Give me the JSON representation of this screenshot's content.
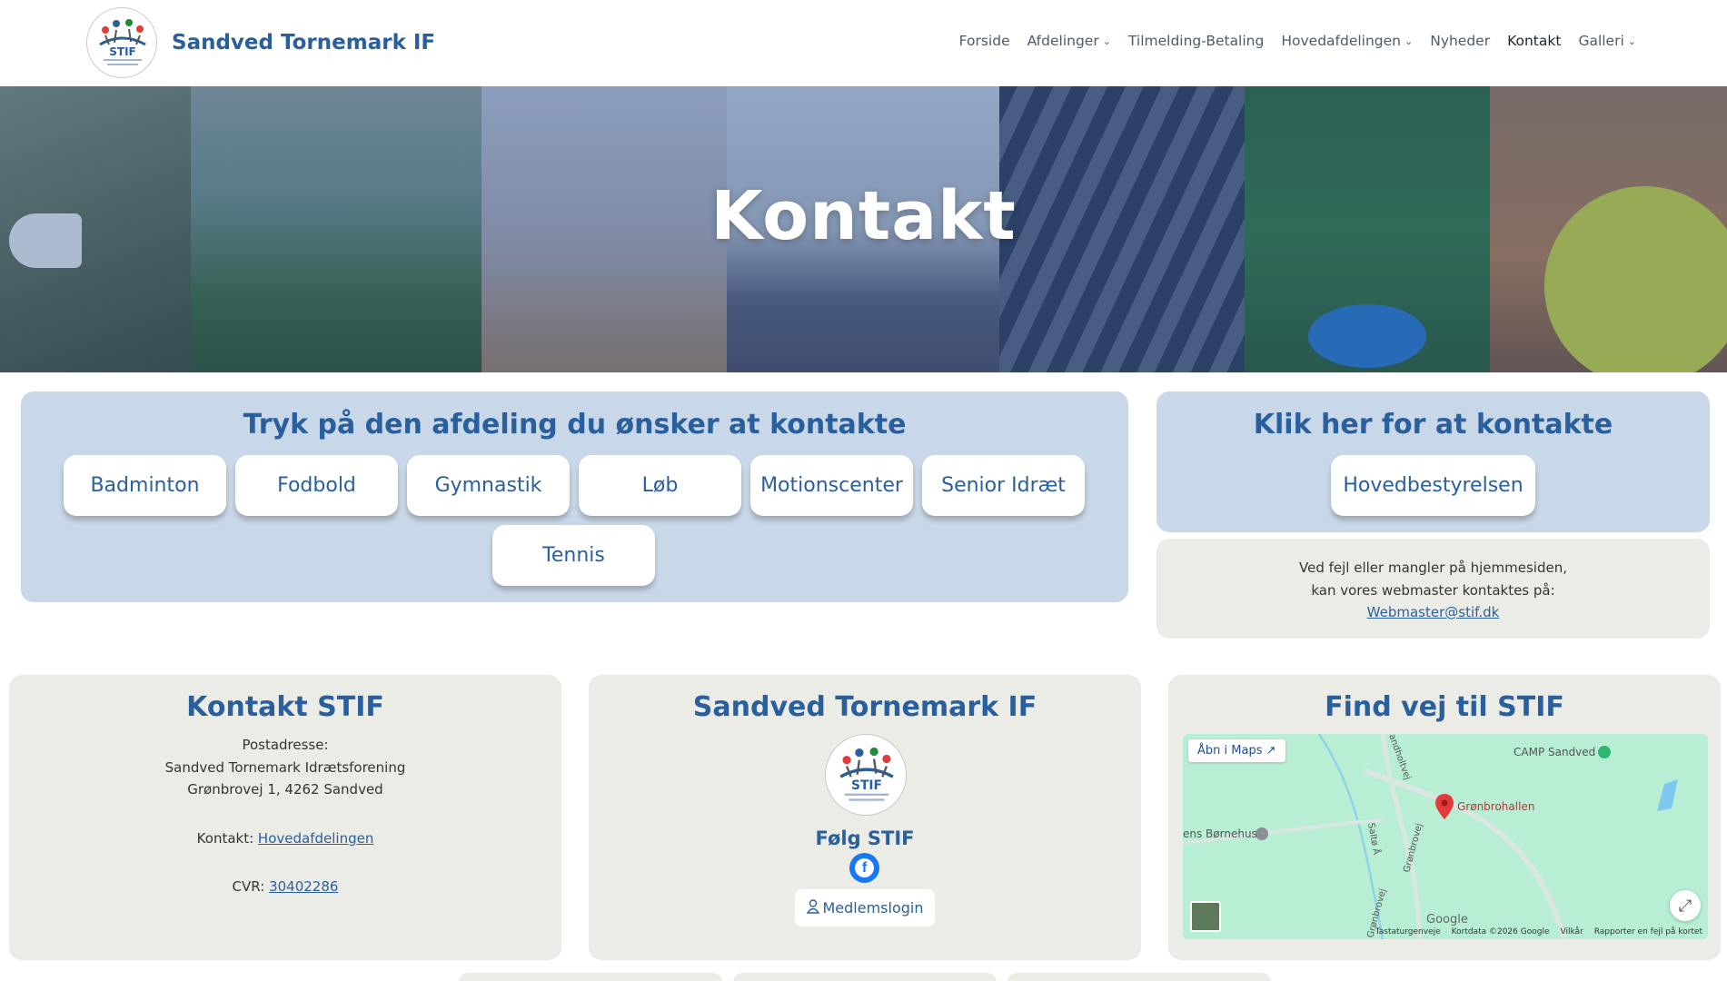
{
  "site": {
    "title": "Sandved Tornemark IF",
    "logo_text": "STIF"
  },
  "nav": {
    "items": [
      {
        "label": "Forside",
        "dropdown": false,
        "active": false
      },
      {
        "label": "Afdelinger",
        "dropdown": true,
        "active": false
      },
      {
        "label": "Tilmelding-Betaling",
        "dropdown": false,
        "active": false
      },
      {
        "label": "Hovedafdelingen",
        "dropdown": true,
        "active": false
      },
      {
        "label": "Nyheder",
        "dropdown": false,
        "active": false
      },
      {
        "label": "Kontakt",
        "dropdown": false,
        "active": true
      },
      {
        "label": "Galleri",
        "dropdown": true,
        "active": false
      }
    ]
  },
  "hero": {
    "title": "Kontakt"
  },
  "departments": {
    "heading": "Tryk på den afdeling du ønsker at kontakte",
    "buttons": [
      "Badminton",
      "Fodbold",
      "Gymnastik",
      "Løb",
      "Motionscenter",
      "Senior Idræt",
      "Tennis"
    ]
  },
  "board": {
    "heading": "Klik her for at kontakte",
    "button": "Hovedbestyrelsen"
  },
  "webmaster": {
    "line1": "Ved fejl eller mangler på hjemmesiden,",
    "line2": "kan vores webmaster kontaktes på:",
    "email": "Webmaster@stif.dk"
  },
  "contact": {
    "heading": "Kontakt STIF",
    "address_label": "Postadresse:",
    "address_name": "Sandved Tornemark Idrætsforening",
    "address_street": "Grønbrovej 1, 4262 Sandved",
    "contact_label": "Kontakt:",
    "contact_link": "Hovedafdelingen",
    "cvr_label": "CVR:",
    "cvr_number": "30402286"
  },
  "club": {
    "heading": "Sandved Tornemark IF",
    "follow": "Følg STIF",
    "facebook_icon": "facebook-icon",
    "login": "Medlemslogin"
  },
  "map": {
    "heading": "Find vej til STIF",
    "open": "Åbn i Maps",
    "labels": {
      "camp": "CAMP Sandved",
      "hall": "Grønbrohallen",
      "kids": "ens Børnehus",
      "road1": "andholtvej",
      "road2": "Grønbrovej",
      "road3": "Saltø Å",
      "road4": "Grønbrovej"
    },
    "footer": [
      "Tastaturgenveje",
      "Kortdata ©2026 Google",
      "Vilkår",
      "Rapporter en fejl på kortet"
    ],
    "google": "Google"
  },
  "colors": {
    "brand": "#2a5f9e",
    "blue_card": "#c9d8e8",
    "grey_card": "#ecece7"
  }
}
